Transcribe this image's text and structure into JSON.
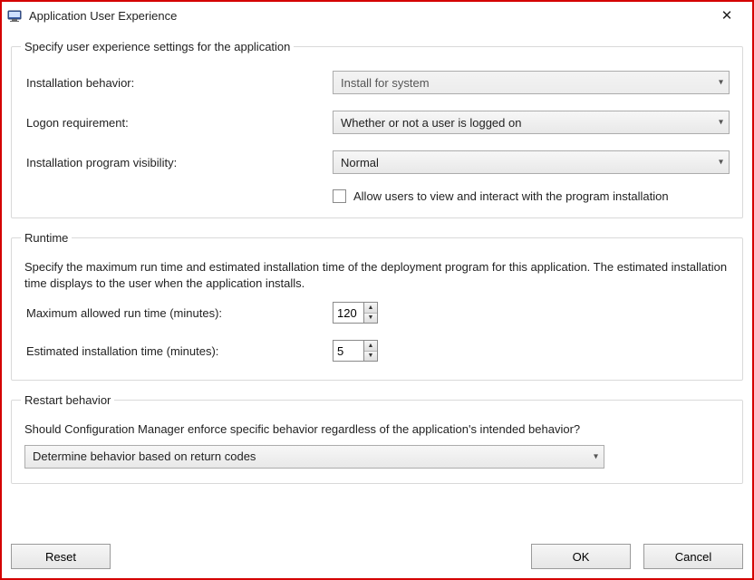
{
  "window": {
    "title": "Application User Experience"
  },
  "group1": {
    "legend": "Specify user experience settings for the application",
    "install_behavior_label": "Installation behavior:",
    "install_behavior_value": "Install for system",
    "logon_req_label": "Logon requirement:",
    "logon_req_value": "Whether or not a user is logged on",
    "visibility_label": "Installation program visibility:",
    "visibility_value": "Normal",
    "allow_interact_label": "Allow users to view and interact with the program installation"
  },
  "runtime": {
    "legend": "Runtime",
    "desc": "Specify the maximum run time and estimated installation time of the deployment program for this application. The estimated installation time displays to the user when the application installs.",
    "max_label": "Maximum allowed run time (minutes):",
    "max_value": "120",
    "est_label": "Estimated installation time (minutes):",
    "est_value": "5"
  },
  "restart": {
    "legend": "Restart behavior",
    "desc": "Should Configuration Manager enforce specific behavior regardless of the application's intended behavior?",
    "value": "Determine behavior based on return codes"
  },
  "buttons": {
    "reset": "Reset",
    "ok": "OK",
    "cancel": "Cancel"
  }
}
